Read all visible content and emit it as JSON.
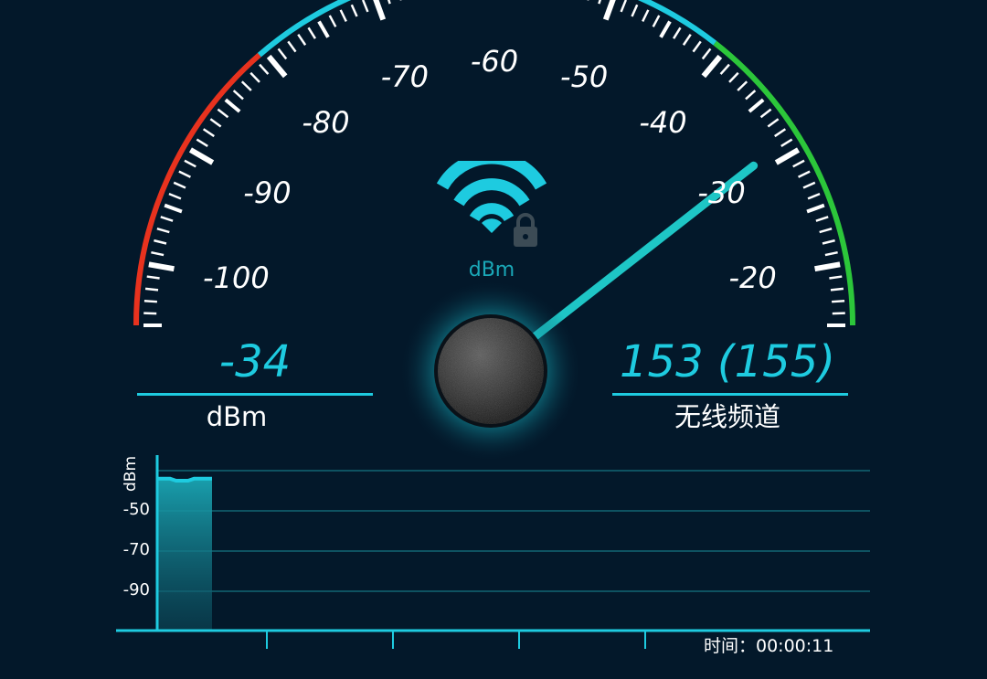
{
  "gauge": {
    "scale_labels": [
      "-100",
      "-90",
      "-80",
      "-70",
      "-60",
      "-50",
      "-40",
      "-30",
      "-20"
    ],
    "min": -105,
    "max": -15,
    "needle_value": -34,
    "center_unit": "dBm",
    "colors": {
      "low": "#e8321e",
      "mid": "#1ecbe0",
      "high": "#2cc63a",
      "tick": "#ffffff",
      "needle": "#1ec6c6"
    }
  },
  "signal": {
    "value": "-34",
    "unit_label": "dBm"
  },
  "channel": {
    "value": "153 (155)",
    "label": "无线频道"
  },
  "history_chart": {
    "y_axis_label": "dBm",
    "y_tick_labels": [
      "-50",
      "-70",
      "-90"
    ],
    "line_color": "#1ecbe0",
    "time_label": "时间：00:00:11"
  },
  "chart_data": {
    "type": "area",
    "ylabel": "dBm",
    "y_ticks": [
      -50,
      -70,
      -90
    ],
    "x_label": "",
    "series": [
      {
        "values": [
          -34,
          -34,
          -34,
          -35,
          -35,
          -35,
          -34,
          -34,
          -34,
          -34
        ]
      }
    ],
    "grid": true
  },
  "icons": {
    "wifi": "wifi-locked-icon",
    "hub": "needle-hub-icon"
  }
}
